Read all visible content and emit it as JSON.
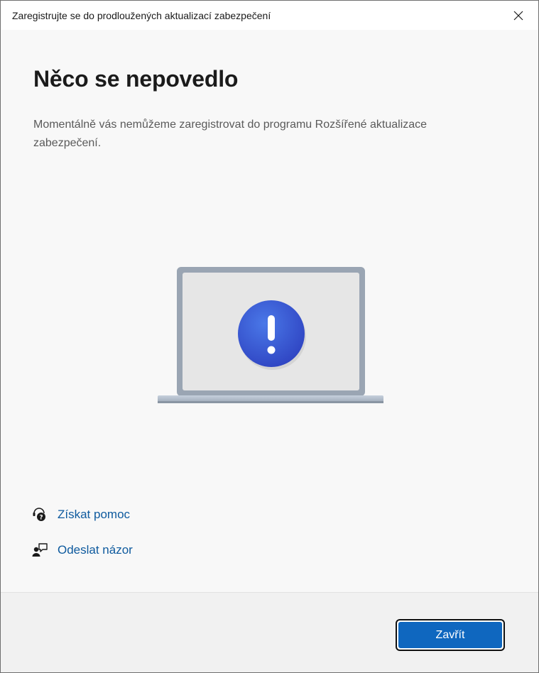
{
  "window": {
    "title": "Zaregistrujte se do prodloužených aktualizací zabezpečení"
  },
  "main": {
    "heading": "Něco se nepovedlo",
    "description": "Momentálně vás nemůžeme zaregistrovat do programu Rozšířené aktualizace zabezpečení.",
    "illustration_icon": "laptop-error-icon"
  },
  "links": {
    "help_label": "Získat pomoc",
    "help_icon": "help-chat-icon",
    "feedback_label": "Odeslat názor",
    "feedback_icon": "feedback-person-icon"
  },
  "footer": {
    "close_label": "Zavřít"
  },
  "colors": {
    "accent": "#0f67bf",
    "link": "#0e5a9e",
    "alert_circle": "#3b5bd6"
  }
}
